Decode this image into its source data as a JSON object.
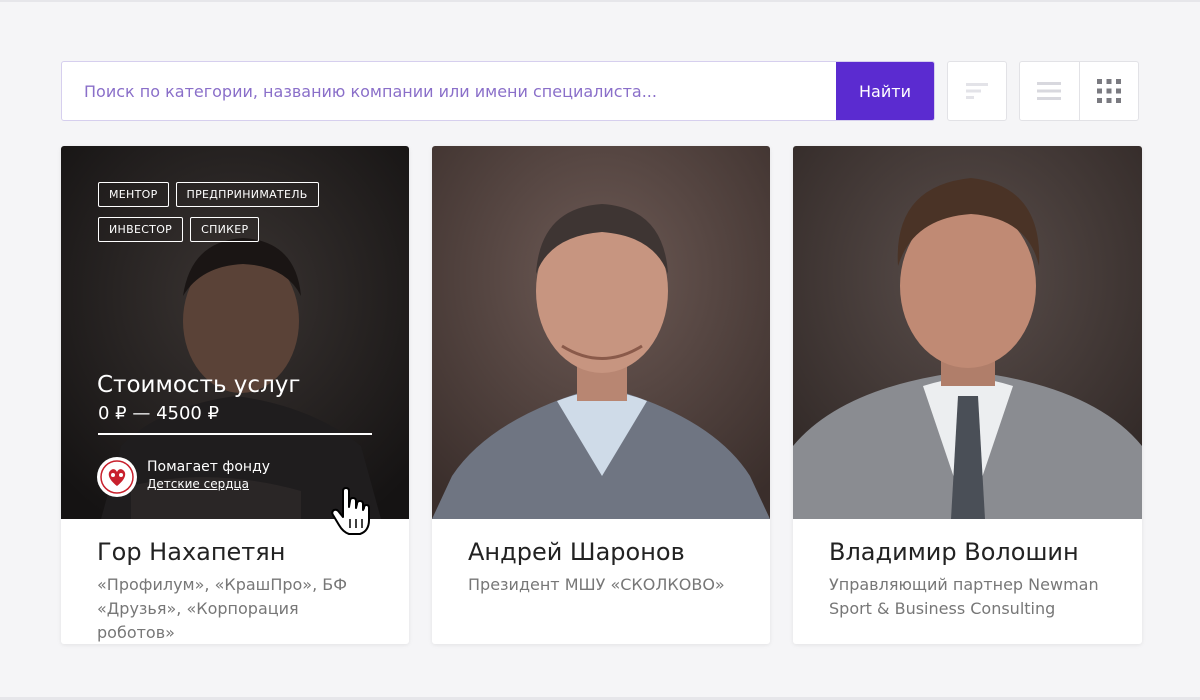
{
  "search": {
    "placeholder": "Поиск по категории, названию компании или имени специалиста...",
    "button_label": "Найти"
  },
  "toolbar": {
    "sort_icon": "sort-icon",
    "list_icon": "list-view-icon",
    "grid_icon": "grid-view-icon"
  },
  "colors": {
    "accent": "#5b2bd0",
    "placeholder": "#8a6fc9",
    "card_bg": "#ffffff",
    "page_bg": "#f5f5f7"
  },
  "cards": [
    {
      "name": "Гор Нахапетян",
      "company": "«Профилум», «КрашПро», БФ «Друзья», «Корпорация роботов»",
      "tags": [
        "МЕНТОР",
        "ПРЕДПРИНИМАТЕЛЬ",
        "ИНВЕСТОР",
        "СПИКЕР"
      ],
      "price_title": "Стоимость услуг",
      "price_range": "0 ₽ — 4500 ₽",
      "fund_text": "Помагает фонду",
      "fund_link": "Детские сердца"
    },
    {
      "name": "Андрей Шаронов",
      "company": "Президент МШУ «СКОЛКОВО»"
    },
    {
      "name": "Владимир Волошин",
      "company": "Управляющий партнер Newman Sport & Business Consulting"
    }
  ]
}
